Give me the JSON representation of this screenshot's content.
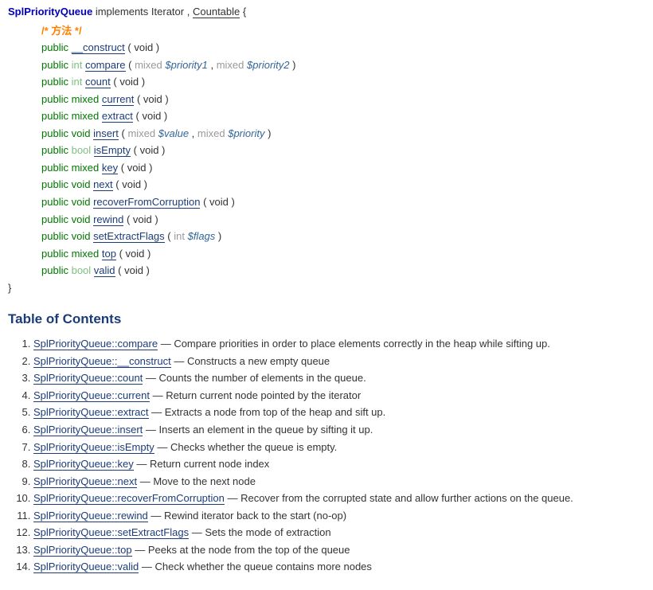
{
  "classsynopsis": {
    "classname": "SplPriorityQueue",
    "keyword_implements": "implements",
    "interface1_text": "Iterator",
    "comma": ",",
    "interface2_text": "Countable",
    "open_brace": "{",
    "close_brace": "}",
    "comment": "/* 方法 */",
    "methods": [
      {
        "modifier": "public",
        "ret": "",
        "ret_class": "",
        "name": "__construct",
        "params_html": " ( void )"
      },
      {
        "modifier": "public",
        "ret": "int",
        "ret_class": "type-int",
        "name": "compare",
        "params_html": " ( <span class='param-type-mixed'>mixed</span> <span class='parameter'>$priority1</span> , <span class='param-type-mixed'>mixed</span> <span class='parameter'>$priority2</span> )"
      },
      {
        "modifier": "public",
        "ret": "int",
        "ret_class": "type-int",
        "name": "count",
        "params_html": " ( void )"
      },
      {
        "modifier": "public",
        "ret": "mixed",
        "ret_class": "type-mixed",
        "name": "current",
        "params_html": " ( void )"
      },
      {
        "modifier": "public",
        "ret": "mixed",
        "ret_class": "type-mixed",
        "name": "extract",
        "params_html": " ( void )"
      },
      {
        "modifier": "public",
        "ret": "void",
        "ret_class": "type-void",
        "name": "insert",
        "params_html": " ( <span class='param-type-mixed'>mixed</span> <span class='parameter'>$value</span> , <span class='param-type-mixed'>mixed</span> <span class='parameter'>$priority</span> )"
      },
      {
        "modifier": "public",
        "ret": "bool",
        "ret_class": "type-bool",
        "name": "isEmpty",
        "params_html": " ( void )"
      },
      {
        "modifier": "public",
        "ret": "mixed",
        "ret_class": "type-mixed",
        "name": "key",
        "params_html": " ( void )"
      },
      {
        "modifier": "public",
        "ret": "void",
        "ret_class": "type-void",
        "name": "next",
        "params_html": " ( void )"
      },
      {
        "modifier": "public",
        "ret": "void",
        "ret_class": "type-void",
        "name": "recoverFromCorruption",
        "params_html": " ( void )"
      },
      {
        "modifier": "public",
        "ret": "void",
        "ret_class": "type-void",
        "name": "rewind",
        "params_html": " ( void )"
      },
      {
        "modifier": "public",
        "ret": "void",
        "ret_class": "type-void",
        "name": "setExtractFlags",
        "params_html": " ( <span class='param-type-int'>int</span> <span class='parameter'>$flags</span> )"
      },
      {
        "modifier": "public",
        "ret": "mixed",
        "ret_class": "type-mixed",
        "name": "top",
        "params_html": " ( void )"
      },
      {
        "modifier": "public",
        "ret": "bool",
        "ret_class": "type-bool",
        "name": "valid",
        "params_html": " ( void )"
      }
    ]
  },
  "toc": {
    "header": "Table of Contents",
    "items": [
      {
        "link": "SplPriorityQueue::compare",
        "desc": "Compare priorities in order to place elements correctly in the heap while sifting up."
      },
      {
        "link": "SplPriorityQueue::__construct",
        "desc": "Constructs a new empty queue"
      },
      {
        "link": "SplPriorityQueue::count",
        "desc": "Counts the number of elements in the queue."
      },
      {
        "link": "SplPriorityQueue::current",
        "desc": "Return current node pointed by the iterator"
      },
      {
        "link": "SplPriorityQueue::extract",
        "desc": "Extracts a node from top of the heap and sift up."
      },
      {
        "link": "SplPriorityQueue::insert",
        "desc": "Inserts an element in the queue by sifting it up."
      },
      {
        "link": "SplPriorityQueue::isEmpty",
        "desc": "Checks whether the queue is empty."
      },
      {
        "link": "SplPriorityQueue::key",
        "desc": "Return current node index"
      },
      {
        "link": "SplPriorityQueue::next",
        "desc": "Move to the next node"
      },
      {
        "link": "SplPriorityQueue::recoverFromCorruption",
        "desc": "Recover from the corrupted state and allow further actions on the queue."
      },
      {
        "link": "SplPriorityQueue::rewind",
        "desc": "Rewind iterator back to the start (no-op)"
      },
      {
        "link": "SplPriorityQueue::setExtractFlags",
        "desc": "Sets the mode of extraction"
      },
      {
        "link": "SplPriorityQueue::top",
        "desc": "Peeks at the node from the top of the queue"
      },
      {
        "link": "SplPriorityQueue::valid",
        "desc": "Check whether the queue contains more nodes"
      }
    ]
  }
}
